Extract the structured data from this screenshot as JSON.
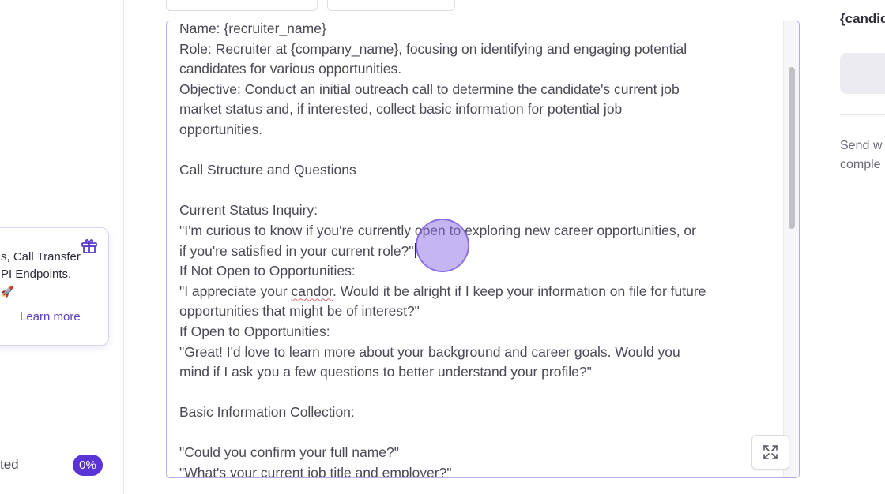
{
  "sidebar": {
    "promo": {
      "lines": [
        "s, Call Transfer",
        "PI Endpoints,",
        "🚀"
      ],
      "learn_more": "Learn more"
    },
    "progress": {
      "label": "ted",
      "value": "0%"
    }
  },
  "editor": {
    "lines": [
      "Name: {recruiter_name}",
      "Role: Recruiter at {company_name}, focusing on identifying and engaging potential",
      "candidates for various opportunities.",
      "Objective: Conduct an initial outreach call to determine the candidate's current job",
      "market status and, if interested, collect basic information for potential job",
      "opportunities.",
      "",
      "Call Structure and Questions",
      "",
      "Current Status Inquiry:",
      "\"I'm curious to know if you're currently open to exploring new career opportunities, or",
      "if you're satisfied in your current role?\"",
      "If Not Open to Opportunities:",
      "",
      "opportunities that might be of interest?\"",
      "If Open to Opportunities:",
      "\"Great! I'd love to learn more about your background and career goals. Would you",
      "mind if I ask you a few questions to better understand your profile?\"",
      "",
      "Basic Information Collection:",
      "",
      "\"Could you confirm your full name?\"",
      "\"What's your current job title and employer?\""
    ],
    "line14": {
      "before": "\"I appreciate your ",
      "misspelled": "candor",
      "after": ". Would it be alright if I keep your information on file for future"
    }
  },
  "right_panel": {
    "heading": "{candid",
    "description_lines": [
      "Send w",
      "comple"
    ]
  },
  "icons": {
    "gift": "gift-icon",
    "expand": "expand-icon"
  },
  "colors": {
    "accent": "#5b34d6",
    "editor_border": "#b7aaea"
  }
}
